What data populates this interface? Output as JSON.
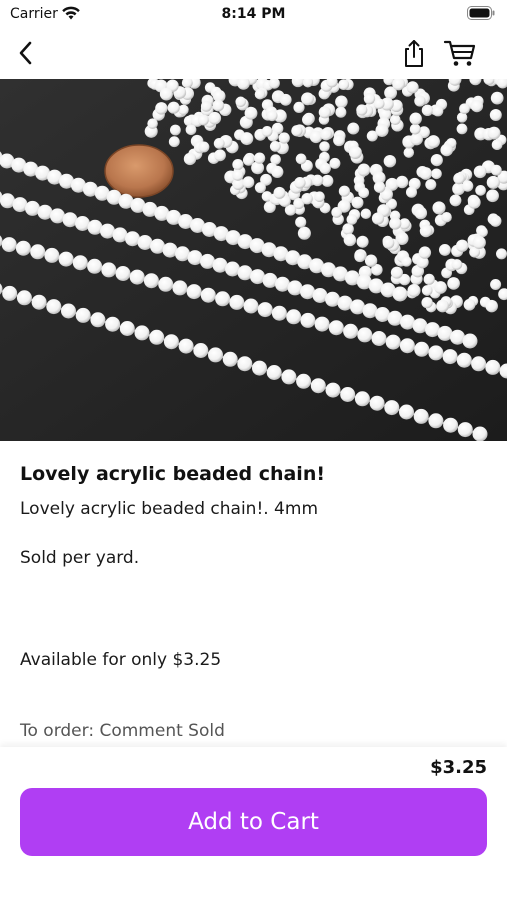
{
  "status_bar": {
    "carrier": "Carrier",
    "time": "8:14 PM"
  },
  "nav": {
    "back_icon": "chevron-left-icon",
    "share_icon": "share-icon",
    "cart_icon": "cart-icon"
  },
  "product": {
    "title": "Lovely acrylic beaded chain!",
    "description": [
      "Lovely acrylic beaded chain!. 4mm",
      "Sold per yard.",
      "Available for only $3.25",
      "To order: Comment Sold"
    ],
    "price": "$3.25"
  },
  "actions": {
    "add_to_cart_label": "Add to Cart"
  },
  "colors": {
    "accent": "#b03ef3",
    "background": "#ffffff"
  }
}
